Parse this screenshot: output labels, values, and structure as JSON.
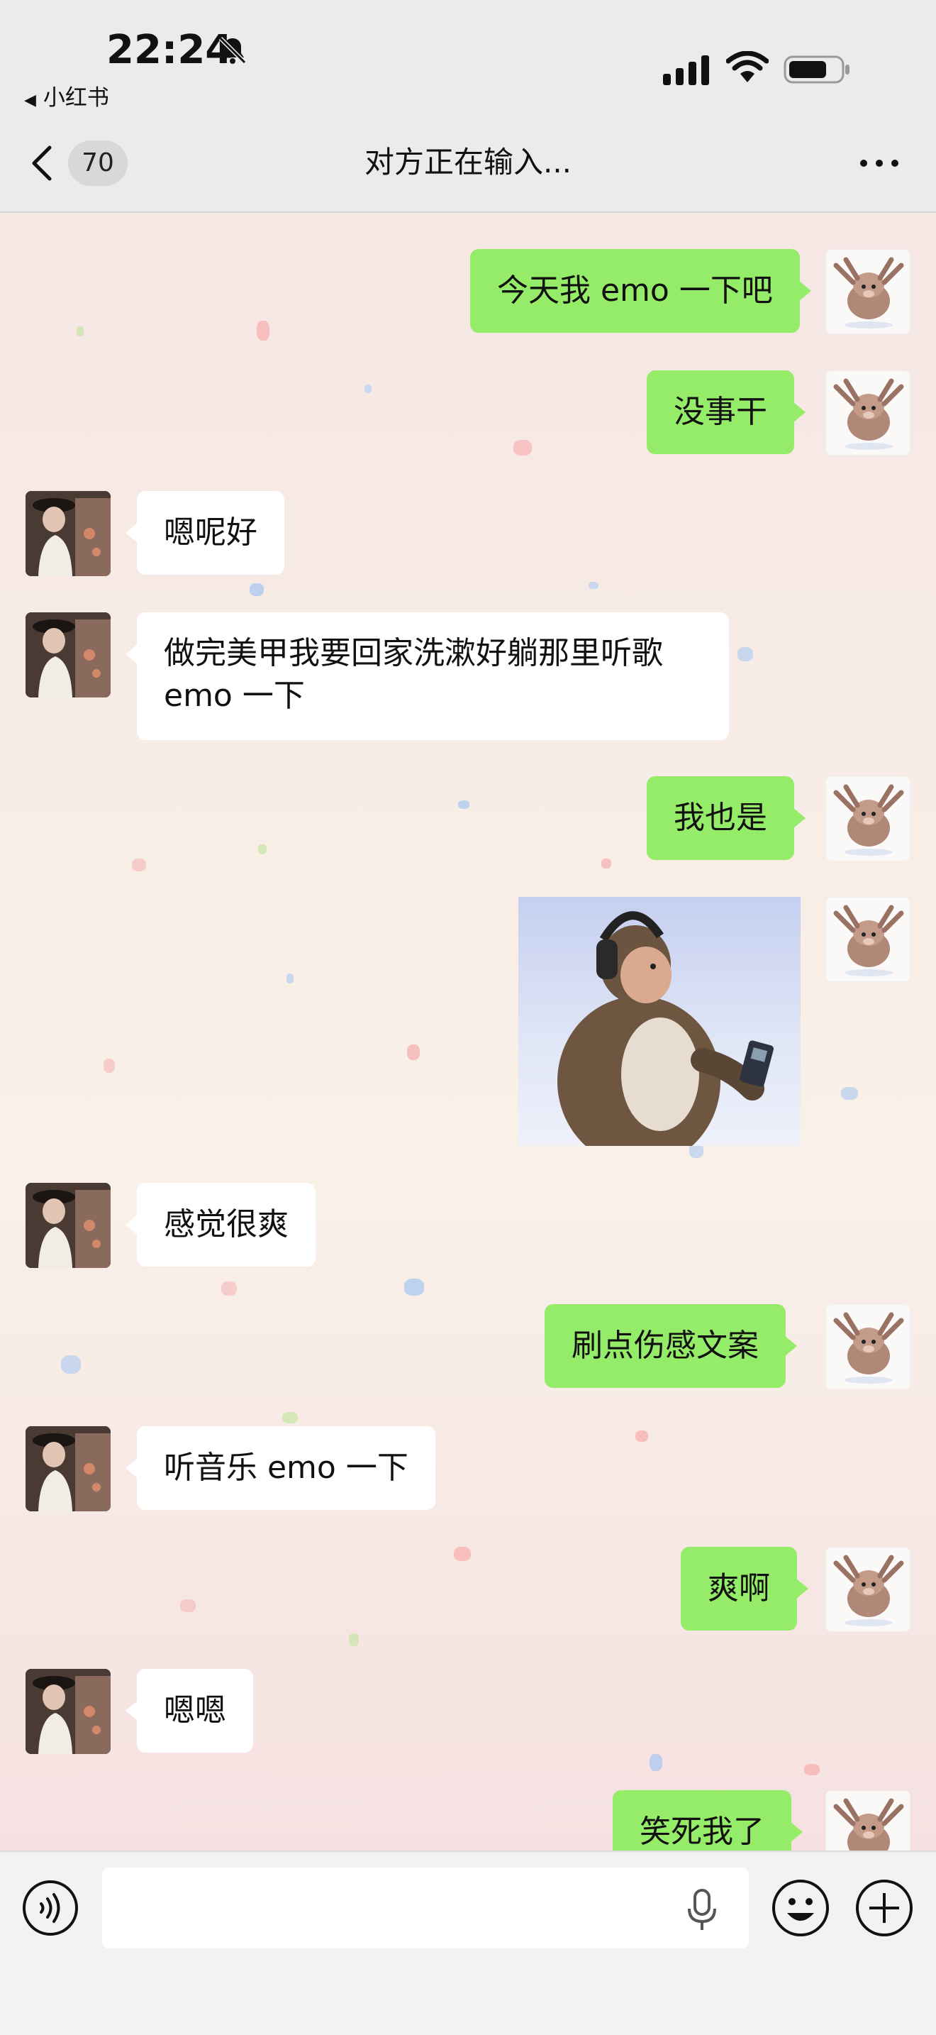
{
  "status_bar": {
    "time": "22:24",
    "back_app_label": "小红书",
    "back_app_arrow": "◀"
  },
  "nav": {
    "unread_count": "70",
    "title": "对方正在输入..."
  },
  "messages": [
    {
      "side": "out",
      "type": "text",
      "text": "今天我 emo 一下吧"
    },
    {
      "side": "out",
      "type": "text",
      "text": "没事干"
    },
    {
      "side": "in",
      "type": "text",
      "text": "嗯呢好"
    },
    {
      "side": "in",
      "type": "text",
      "text": "做完美甲我要回家洗漱好躺那里听歌 emo 一下"
    },
    {
      "side": "out",
      "type": "text",
      "text": "我也是"
    },
    {
      "side": "out",
      "type": "sticker",
      "icon": "monkey-headphones-sticker"
    },
    {
      "side": "in",
      "type": "text",
      "text": "感觉很爽"
    },
    {
      "side": "out",
      "type": "text",
      "text": "刷点伤感文案"
    },
    {
      "side": "in",
      "type": "text",
      "text": "听音乐 emo 一下"
    },
    {
      "side": "out",
      "type": "text",
      "text": "爽啊"
    },
    {
      "side": "in",
      "type": "text",
      "text": "嗯嗯"
    },
    {
      "side": "out",
      "type": "text",
      "text": "笑死我了"
    }
  ],
  "input_bar": {
    "placeholder": "",
    "icons": [
      "voice-icon",
      "mic-icon",
      "emoji-icon",
      "plus-icon"
    ]
  },
  "colors": {
    "bubble_out": "#95ec69",
    "bubble_in": "#ffffff",
    "bar_bg": "#ebebeb"
  }
}
